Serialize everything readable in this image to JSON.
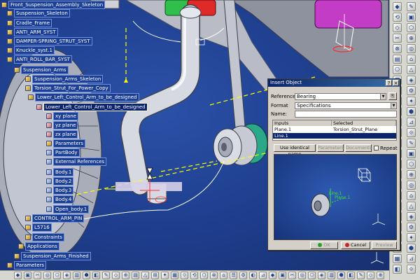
{
  "tree": {
    "items": [
      {
        "label": "Front_Suspension_Assembly_Skeleton"
      },
      {
        "label": "Suspension_Skeleton"
      },
      {
        "label": "Cradle_Frame"
      },
      {
        "label": "ANTI_ARM_SYST"
      },
      {
        "label": "DAMPER-SPRING_STRUT_SYST"
      },
      {
        "label": "Knuckle_syst.1"
      },
      {
        "label": "ANTI_ROLL_BAR_SYST"
      },
      {
        "label": "Suspension_Arms"
      },
      {
        "label": "Suspension_Arms_Skeleton"
      },
      {
        "label": "Torsion_Strut_For_Power_Copy"
      },
      {
        "label": "Lower_Left_Control_Arm_to_be_designed"
      },
      {
        "label": "Lower_Left_Control_Arm_to_be_designed"
      },
      {
        "label": "xy plane"
      },
      {
        "label": "yz plane"
      },
      {
        "label": "zx plane"
      },
      {
        "label": "Parameters"
      },
      {
        "label": "PartBody"
      },
      {
        "label": "External References"
      },
      {
        "label": "Body.1"
      },
      {
        "label": "Body.2"
      },
      {
        "label": "Body.3"
      },
      {
        "label": "Body.4"
      },
      {
        "label": "Open_body.1"
      },
      {
        "label": "CONTROL_ARM_PIN"
      },
      {
        "label": "L5716"
      },
      {
        "label": "Constraints"
      },
      {
        "label": "Applications"
      },
      {
        "label": "Suspension_Arms_Finished"
      },
      {
        "label": "Parameters"
      }
    ]
  },
  "dialog": {
    "title": "Insert Object",
    "reference_label": "Reference:",
    "reference_value": "Bearing",
    "format_label": "Format",
    "format_value": "Specifications",
    "name_label": "Name:",
    "name_value": "",
    "table_headers": [
      "Inputs",
      "Selected"
    ],
    "table_rows": [
      {
        "input": "Plane.1",
        "selected": "Torsion_Strut_Plane"
      },
      {
        "input": "Line.1",
        "selected": ""
      }
    ],
    "use_identical_name": "Use identical name",
    "parameters_button": "Parameters",
    "documents_button": "Documents",
    "repeat_label": "Repeat",
    "preview_labels": {
      "line": "Line.1",
      "plane": "Plane.1"
    },
    "ok_label": "OK",
    "cancel_label": "Cancel",
    "preview_label": "Preview"
  },
  "colors": {
    "viewport_bg": "#1e3d8c",
    "tree_label_bg": "#1c3f95",
    "dialog_bg": "#d4d0c8",
    "title_bar": "#0a246a",
    "ok_green": "#2aa02a",
    "cancel_red": "#cc2222",
    "selection_axis": "#ffff00"
  }
}
